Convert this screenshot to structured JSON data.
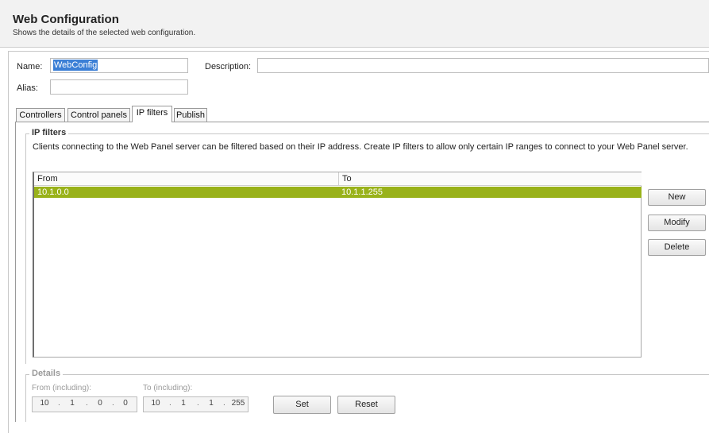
{
  "header": {
    "title": "Web Configuration",
    "subtitle": "Shows the details of the selected web configuration."
  },
  "form": {
    "name_label": "Name:",
    "name_value": "WebConfig",
    "description_label": "Description:",
    "description_value": "",
    "alias_label": "Alias:",
    "alias_value": ""
  },
  "tabs": [
    {
      "label": "Controllers",
      "active": false
    },
    {
      "label": "Control panels",
      "active": false
    },
    {
      "label": "IP filters",
      "active": true
    },
    {
      "label": "Publish",
      "active": false
    }
  ],
  "ip_filters": {
    "group_title": "IP filters",
    "description": "Clients connecting to the Web Panel server can be filtered based on their IP address. Create IP filters to allow only certain IP ranges to connect to your Web Panel server.",
    "columns": [
      "From",
      "To"
    ],
    "rows": [
      {
        "from": "10.1.0.0",
        "to": "10.1.1.255",
        "selected": true
      }
    ],
    "buttons": {
      "new": "New",
      "modify": "Modify",
      "delete": "Delete"
    },
    "selection_color": "#99b21a"
  },
  "details": {
    "group_title": "Details",
    "from_label": "From (including):",
    "to_label": "To (including):",
    "from_octets": [
      "10",
      "1",
      "0",
      "0"
    ],
    "to_octets": [
      "10",
      "1",
      "1",
      "255"
    ],
    "set_label": "Set",
    "reset_label": "Reset"
  }
}
